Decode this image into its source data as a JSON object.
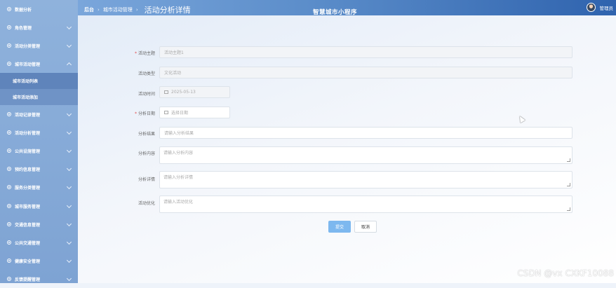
{
  "sidebar": {
    "items": [
      {
        "label": "数据分析",
        "has_chevron": false
      },
      {
        "label": "角色管理",
        "has_chevron": true
      },
      {
        "label": "活动分类管理",
        "has_chevron": true
      },
      {
        "label": "城市活动管理",
        "has_chevron": true,
        "expanded": true
      },
      {
        "label": "活动记录管理",
        "has_chevron": true
      },
      {
        "label": "活动分析管理",
        "has_chevron": true
      },
      {
        "label": "公共设施管理",
        "has_chevron": true
      },
      {
        "label": "预约信息管理",
        "has_chevron": true
      },
      {
        "label": "服务分类管理",
        "has_chevron": true
      },
      {
        "label": "城市服务管理",
        "has_chevron": true
      },
      {
        "label": "交通信息管理",
        "has_chevron": true
      },
      {
        "label": "公共交通管理",
        "has_chevron": true
      },
      {
        "label": "健康安全管理",
        "has_chevron": true
      },
      {
        "label": "反馈提醒管理",
        "has_chevron": true
      }
    ],
    "subitems": [
      {
        "label": "城市活动列表",
        "active": true
      },
      {
        "label": "城市活动添加",
        "active": false
      }
    ]
  },
  "header": {
    "breadcrumb_home": "后台",
    "breadcrumb_section": "城市活动管理",
    "page_title": "活动分析详情",
    "app_title": "智慧城市小程序",
    "user": "管理员"
  },
  "form": {
    "fields": [
      {
        "label": "活动主题",
        "required": true,
        "value": "活动主题1",
        "type": "text",
        "disabled": true
      },
      {
        "label": "活动类型",
        "required": false,
        "value": "文化活动",
        "type": "text",
        "disabled": true
      },
      {
        "label": "活动时间",
        "required": false,
        "value": "2025-05-13",
        "type": "date",
        "disabled": true
      },
      {
        "label": "分析日期",
        "required": true,
        "placeholder": "选择日期",
        "type": "date",
        "disabled": false
      },
      {
        "label": "分析结果",
        "required": false,
        "placeholder": "请输入分析结果",
        "type": "text",
        "disabled": false
      },
      {
        "label": "分析内容",
        "required": false,
        "placeholder": "请输入分析内容",
        "type": "textarea"
      },
      {
        "label": "分析详情",
        "required": false,
        "placeholder": "请输入分析详情",
        "type": "textarea"
      },
      {
        "label": "活动优化",
        "required": false,
        "placeholder": "请输入活动优化",
        "type": "textarea"
      }
    ],
    "submit_label": "提交",
    "cancel_label": "取消"
  },
  "watermark": "CSDN @vx  CXKF10088",
  "colors": {
    "sidebar": "#8fb2dc",
    "header_end": "#2f63ae",
    "primary_button": "#7db8ef",
    "required": "#e34d4d"
  }
}
